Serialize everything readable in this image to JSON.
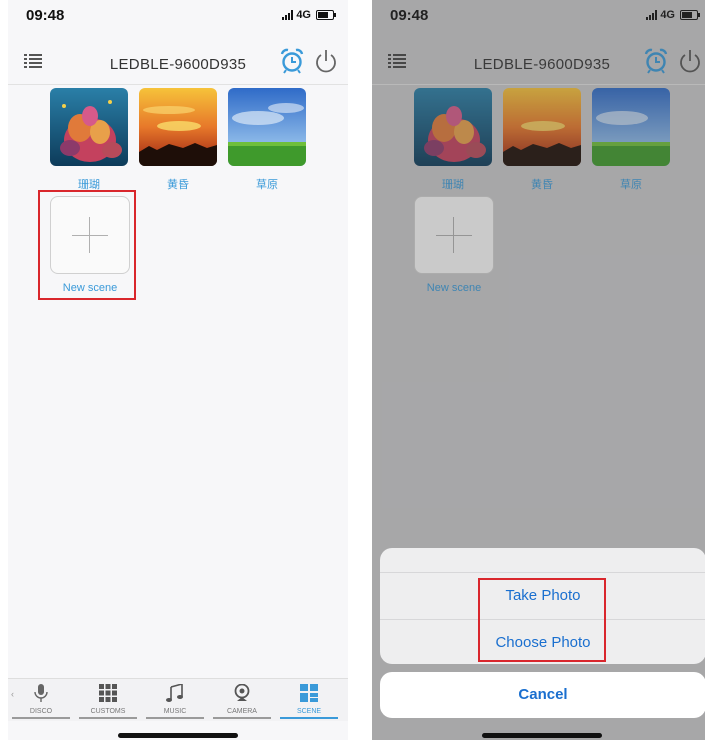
{
  "status": {
    "time": "09:48",
    "network": "4G"
  },
  "header": {
    "title": "LEDBLE-9600D935"
  },
  "scenes": [
    {
      "label": "珊瑚"
    },
    {
      "label": "黄昏"
    },
    {
      "label": "草原"
    }
  ],
  "new_scene": {
    "label": "New scene"
  },
  "tabs": [
    {
      "label": "DISCO",
      "icon": "microphone-icon"
    },
    {
      "label": "CUSTOMS",
      "icon": "grid-icon"
    },
    {
      "label": "MUSIC",
      "icon": "music-note-icon"
    },
    {
      "label": "CAMERA",
      "icon": "webcam-icon"
    },
    {
      "label": "SCENE",
      "icon": "scene-icon",
      "active": true
    }
  ],
  "action_sheet": {
    "take_photo": "Take Photo",
    "choose_photo": "Choose Photo",
    "cancel": "Cancel"
  },
  "colors": {
    "accent": "#3a9ad9",
    "link": "#1a6fcf",
    "highlight": "#d9262c"
  }
}
